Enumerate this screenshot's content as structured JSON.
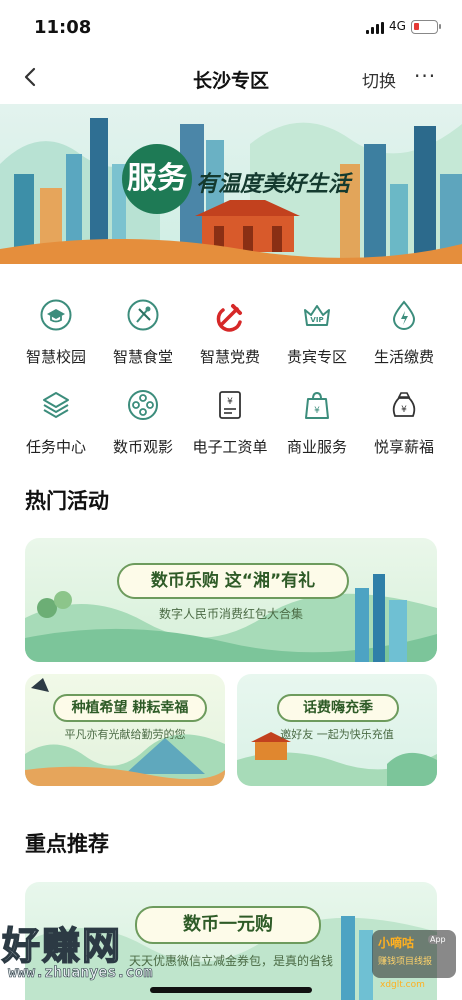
{
  "status_bar": {
    "time": "11:08",
    "network": "4G"
  },
  "nav": {
    "title": "长沙专区",
    "switch_label": "切换",
    "more_label": "···"
  },
  "banner": {
    "badge_text": "服务",
    "slogan": "有温度美好生活"
  },
  "services": [
    {
      "label": "智慧校园",
      "icon": "graduation-cap-icon"
    },
    {
      "label": "智慧食堂",
      "icon": "fork-knife-icon"
    },
    {
      "label": "智慧党费",
      "icon": "hammer-sickle-icon"
    },
    {
      "label": "贵宾专区",
      "icon": "vip-crown-icon"
    },
    {
      "label": "生活缴费",
      "icon": "lightning-drop-icon"
    },
    {
      "label": "任务中心",
      "icon": "layers-icon"
    },
    {
      "label": "数币观影",
      "icon": "film-reel-icon"
    },
    {
      "label": "电子工资单",
      "icon": "payslip-icon"
    },
    {
      "label": "商业服务",
      "icon": "shopping-bag-icon"
    },
    {
      "label": "悦享薪福",
      "icon": "money-bag-icon"
    }
  ],
  "hot": {
    "title": "热门活动",
    "big_card": {
      "title": "数币乐购 这“湘”有礼",
      "subtitle": "数字人民币消费红包大合集"
    },
    "left_card": {
      "title": "种植希望 耕耘幸福",
      "subtitle": "平凡亦有光献给勤劳的您"
    },
    "right_card": {
      "title": "话费嗨充季",
      "subtitle": "邀好友 一起为快乐充值"
    }
  },
  "featured": {
    "title": "重点推荐",
    "card": {
      "title": "数币一元购",
      "subtitle": "天天优惠微信立减金券包，是真的省钱"
    }
  },
  "watermark": {
    "left_big": "好赚网",
    "left_url": "www.zhuanyes.com",
    "right_name": "小嘀咕",
    "right_app": "App",
    "right_sub": "赚钱项目线报",
    "right_url": "xdglt.com"
  },
  "colors": {
    "accent": "#2a9d8f",
    "party_red": "#d62828",
    "ribbon_green": "#2e5b27"
  }
}
